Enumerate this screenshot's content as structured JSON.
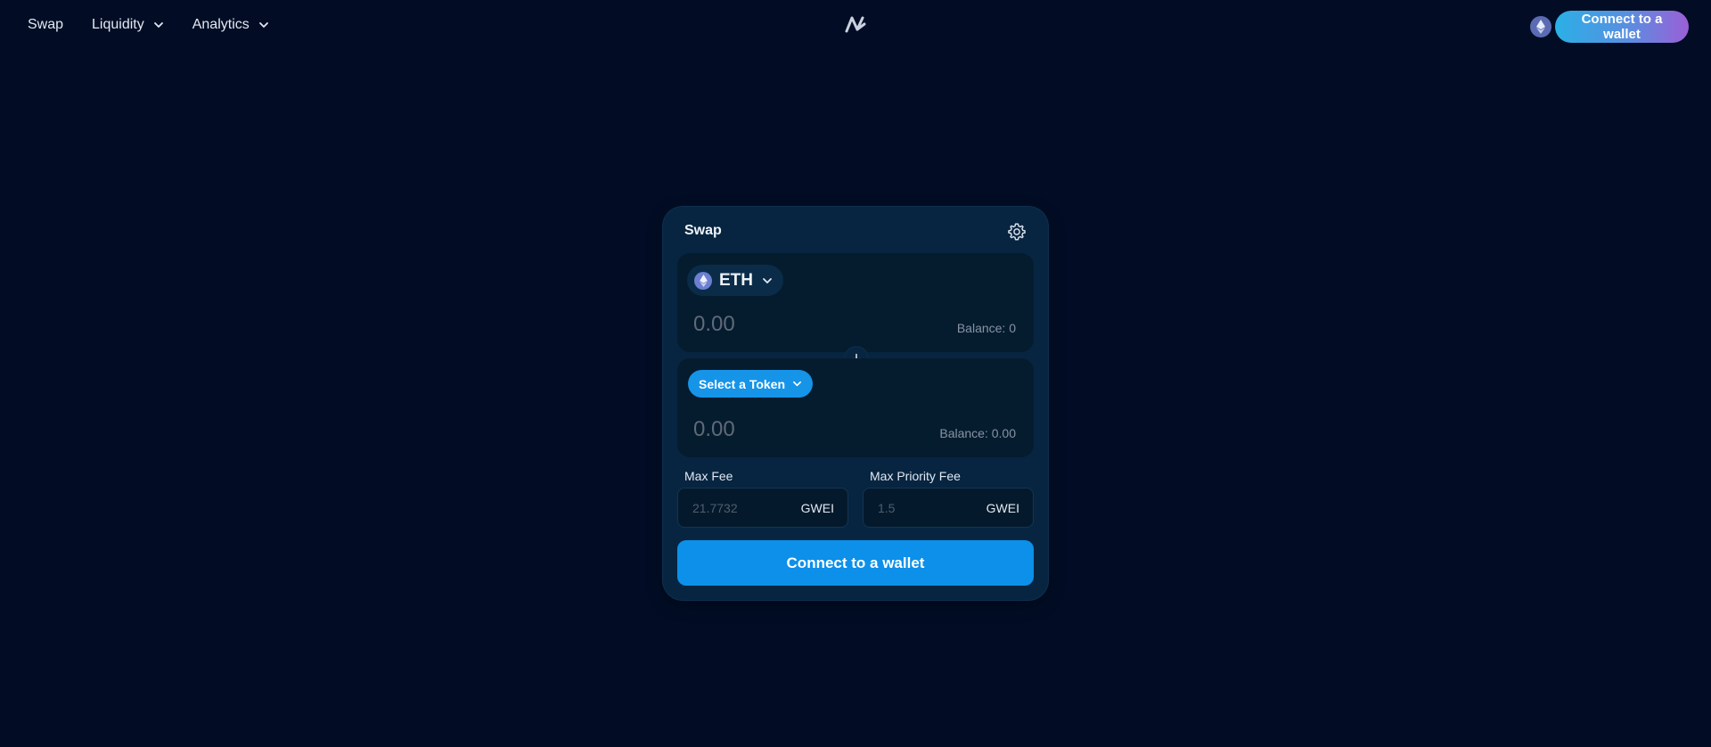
{
  "nav": {
    "items": [
      {
        "label": "Swap",
        "dropdown": false
      },
      {
        "label": "Liquidity",
        "dropdown": true
      },
      {
        "label": "Analytics",
        "dropdown": true
      }
    ]
  },
  "header": {
    "logo_icon": "zigzag-logo-icon",
    "network_icon": "ethereum-icon",
    "connect_label": "Connect to a wallet"
  },
  "swap": {
    "title": "Swap",
    "settings_icon": "gear-icon",
    "from": {
      "token_symbol": "ETH",
      "token_icon": "ethereum-icon",
      "amount_placeholder": "0.00",
      "balance": "Balance: 0"
    },
    "switch_icon": "arrow-down-icon",
    "to": {
      "select_label": "Select a Token",
      "amount_placeholder": "0.00",
      "balance": "Balance: 0.00"
    },
    "max_fee": {
      "label": "Max Fee",
      "placeholder": "21.7732",
      "unit": "GWEI"
    },
    "max_priority_fee": {
      "label": "Max Priority Fee",
      "placeholder": "1.5",
      "unit": "GWEI"
    },
    "connect_label": "Connect to a wallet"
  },
  "colors": {
    "background": "#020d25",
    "card": "#072540",
    "accent": "#0c90ea"
  }
}
